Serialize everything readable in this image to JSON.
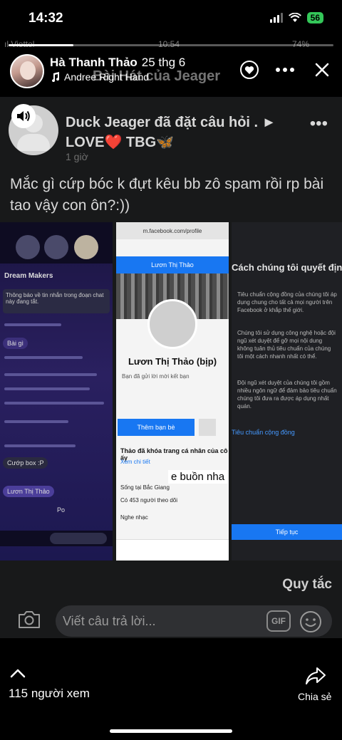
{
  "status_bar": {
    "time": "14:32",
    "battery": "56",
    "icons": [
      "signal-icon",
      "wifi-icon",
      "battery-icon"
    ]
  },
  "story": {
    "progress": 0.2,
    "ghost_status": {
      "carrier": "ıl Viettel",
      "time": "10:54",
      "battery": "74%"
    },
    "author": "Hà Thanh Thảo",
    "date": "25 thg 6",
    "song": "Andree Right Hand",
    "song_ghost": "Bài Hát của Jeager"
  },
  "post": {
    "author_line": "Duck Jeager đã đặt câu hỏi . ►",
    "tagline_prefix": "LOVE",
    "tagline_suffix": "TBG🦋",
    "time": "1 giờ",
    "text": "Mắc gì cứp bóc k đựt kêu bb zô spam rồi rp bài tao vậy con ôn?:))",
    "overlay_tag": "e buồn nha",
    "screenshots": {
      "messenger": {
        "group": "Dream Makers",
        "notice": "Thông báo về tin nhắn trong đoạn chat này đang tắt.",
        "messages": [
          "Bài gì",
          "Cướp box :P",
          "Lươn Thị Thảo",
          "Po"
        ]
      },
      "profile": {
        "url": "m.facebook.com/profile",
        "bar_title": "Lươn Thị Thảo",
        "name": "Lươn Thị Thảo (bịp)",
        "subtitle": "Bạn đã gửi lời mời kết bạn",
        "add_friend": "Thêm bạn bè",
        "locked": "Thảo đã khóa trang cá nhân của cô ấy",
        "see_details": "Xem chi tiết",
        "info": [
          "Sống tại Bắc Giang",
          "Có 453 người theo dõi",
          "Nghe nhạc"
        ]
      },
      "standards": {
        "title": "Cách chúng tôi quyết định",
        "paragraphs": [
          "Tiêu chuẩn cộng đồng của chúng tôi áp dụng chung cho tất cả mọi người trên Facebook ở khắp thế giới.",
          "Chúng tôi sử dụng công nghệ hoặc đội ngũ xét duyệt để gỡ mọi nội dung không tuân thủ tiêu chuẩn của chúng tôi một cách nhanh nhất có thể.",
          "Đội ngũ xét duyệt của chúng tôi gồm nhiều ngôn ngữ để đảm bảo tiêu chuẩn chúng tôi đưa ra được áp dụng nhất quán."
        ],
        "link": "Tiêu chuẩn cộng đồng",
        "button": "Tiếp tục"
      }
    }
  },
  "reply": {
    "rules_label": "Quy tắc",
    "placeholder": "Viết câu trả lời...",
    "gif_label": "GIF"
  },
  "footer": {
    "viewers": "115 người xem",
    "share_label": "Chia sẻ"
  }
}
